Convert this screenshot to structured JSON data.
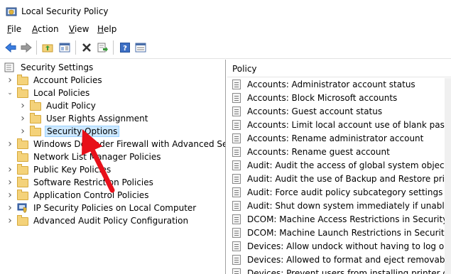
{
  "window": {
    "title": "Local Security Policy",
    "app_icon": "security-policy-icon"
  },
  "menu": [
    {
      "label": "File",
      "u": "F",
      "rest": "ile"
    },
    {
      "label": "Action",
      "u": "A",
      "rest": "ction"
    },
    {
      "label": "View",
      "u": "V",
      "rest": "iew"
    },
    {
      "label": "Help",
      "u": "H",
      "rest": "elp"
    }
  ],
  "toolbar": [
    {
      "name": "back-icon"
    },
    {
      "name": "forward-icon"
    },
    {
      "name": "up-folder-icon"
    },
    {
      "name": "show-hide-tree-icon"
    },
    {
      "name": "delete-icon"
    },
    {
      "name": "export-list-icon"
    },
    {
      "name": "help-icon"
    },
    {
      "name": "properties-icon"
    }
  ],
  "tree": [
    {
      "label": "Security Settings",
      "level": 0,
      "expander": "down",
      "icon": "security-settings-icon"
    },
    {
      "label": "Account Policies",
      "level": 1,
      "expander": "right",
      "icon": "folder-icon"
    },
    {
      "label": "Local Policies",
      "level": 1,
      "expander": "down",
      "icon": "folder-icon"
    },
    {
      "label": "Audit Policy",
      "level": 2,
      "expander": "right",
      "icon": "folder-icon"
    },
    {
      "label": "User Rights Assignment",
      "level": 2,
      "expander": "right",
      "icon": "folder-icon"
    },
    {
      "label": "Security Options",
      "level": 2,
      "expander": "right",
      "icon": "folder-icon",
      "selected": true
    },
    {
      "label": "Windows Defender Firewall with Advanced Security",
      "level": 1,
      "expander": "right",
      "icon": "folder-icon"
    },
    {
      "label": "Network List Manager Policies",
      "level": 1,
      "expander": "none",
      "icon": "folder-icon"
    },
    {
      "label": "Public Key Policies",
      "level": 1,
      "expander": "right",
      "icon": "folder-icon"
    },
    {
      "label": "Software Restriction Policies",
      "level": 1,
      "expander": "right",
      "icon": "folder-icon"
    },
    {
      "label": "Application Control Policies",
      "level": 1,
      "expander": "right",
      "icon": "folder-icon"
    },
    {
      "label": "IP Security Policies on Local Computer",
      "level": 1,
      "expander": "right",
      "icon": "ip-security-icon"
    },
    {
      "label": "Advanced Audit Policy Configuration",
      "level": 1,
      "expander": "right",
      "icon": "folder-icon"
    }
  ],
  "list": {
    "header": "Policy",
    "items": [
      "Accounts: Administrator account status",
      "Accounts: Block Microsoft accounts",
      "Accounts: Guest account status",
      "Accounts: Limit local account use of blank passwords to",
      "Accounts: Rename administrator account",
      "Accounts: Rename guest account",
      "Audit: Audit the access of global system objects",
      "Audit: Audit the use of Backup and Restore privilege",
      "Audit: Force audit policy subcategory settings (Window",
      "Audit: Shut down system immediately if unable to log s",
      "DCOM: Machine Access Restrictions in Security Descrip",
      "DCOM: Machine Launch Restrictions in Security Descrip",
      "Devices: Allow undock without having to log on",
      "Devices: Allowed to format and eject removable media",
      "Devices: Prevent users from installing printer drivers"
    ]
  },
  "annotation": {
    "color": "#e8101a",
    "icon": "red-arrow-pointer"
  }
}
